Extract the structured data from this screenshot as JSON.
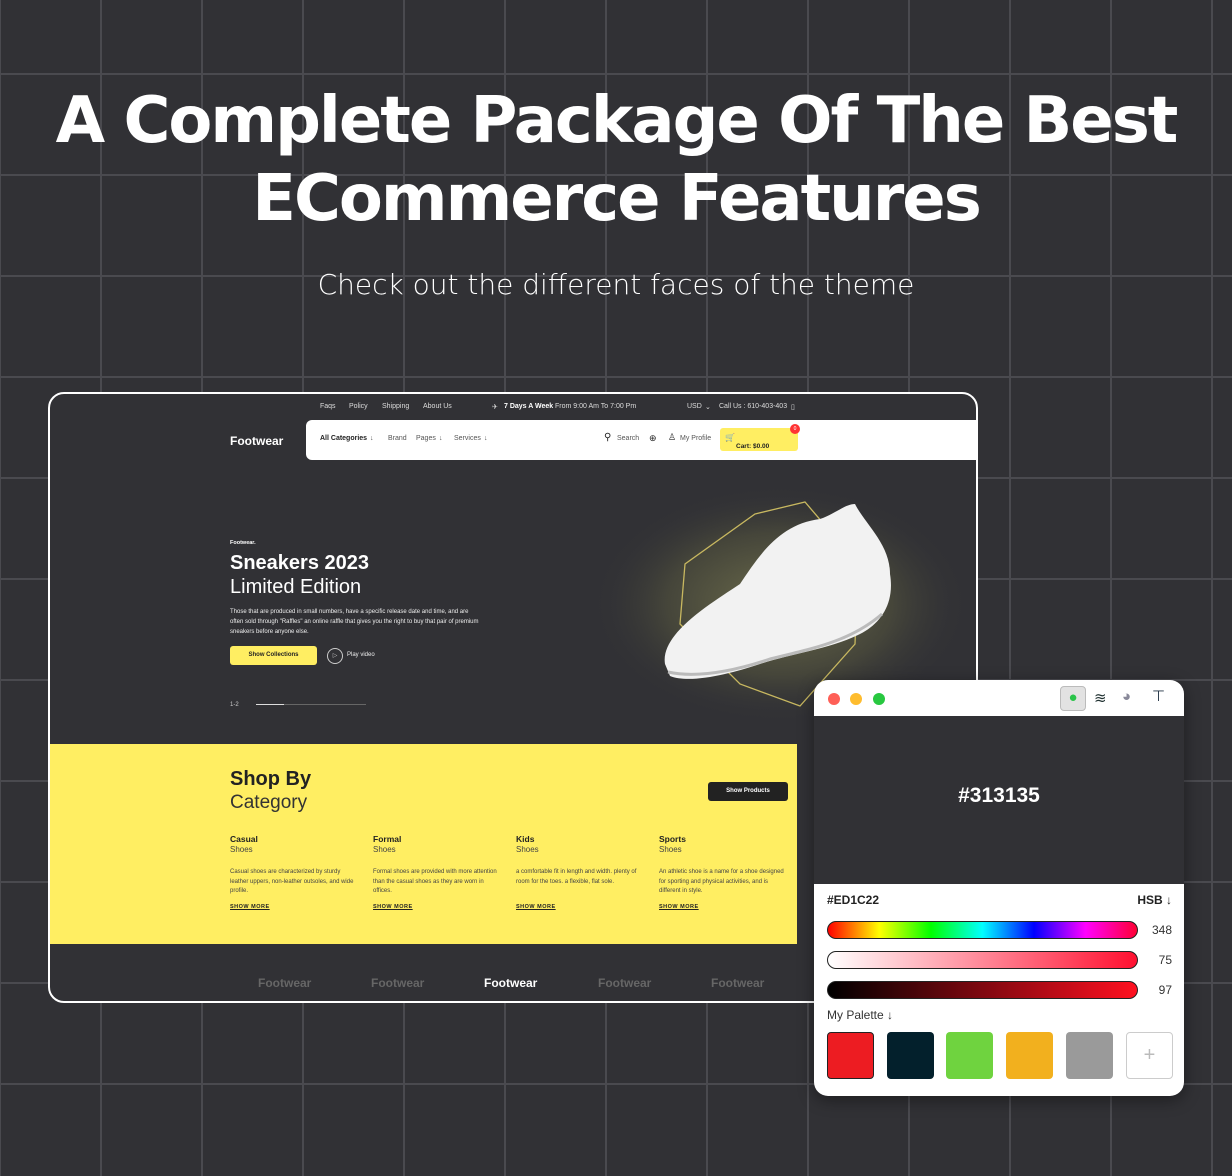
{
  "headline": "A Complete Package Of The Best ECommerce Features",
  "subtitle": "Check out the different faces of the theme",
  "site": {
    "topbar": {
      "links": [
        "Faqs",
        "Policy",
        "Shipping",
        "About Us"
      ],
      "hours_bold": "7 Days A Week",
      "hours": "From 9:00 Am To 7:00 Pm",
      "currency": "USD",
      "call": "Call Us : 610-403-403"
    },
    "logo": "Footwear",
    "nav": {
      "items": [
        "All Categories",
        "Brand",
        "Pages",
        "Services"
      ],
      "search": "Search",
      "profile": "My Profile",
      "cart": "Cart: $0.00",
      "cart_count": "0"
    },
    "hero": {
      "eyebrow": "Footwear.",
      "title": "Sneakers 2023",
      "title2": "Limited Edition",
      "text": "Those that are produced in small numbers, have a specific release date and time, and are often sold through \"Raffles\" an online raffle that gives you the right to buy that pair of premium sneakers before anyone else.",
      "cta": "Show Collections",
      "play": "Play video",
      "pager": "1-2",
      "progress": 0.25
    },
    "shop": {
      "title": "Shop By",
      "title2": "Category",
      "button": "Show Products",
      "categories": [
        {
          "title": "Casual",
          "sub": "Shoes",
          "text": "Casual shoes are characterized by sturdy leather uppers, non-leather outsoles, and wide profile.",
          "more": "SHOW MORE"
        },
        {
          "title": "Formal",
          "sub": "Shoes",
          "text": "Formal shoes are provided with more attention than the casual shoes as they are worn in offices.",
          "more": "SHOW MORE"
        },
        {
          "title": "Kids",
          "sub": "Shoes",
          "text": "a comfortable fit in length and width. plenty of room for the toes. a flexible, flat sole.",
          "more": "SHOW MORE"
        },
        {
          "title": "Sports",
          "sub": "Shoes",
          "text": "An athletic shoe is a name for a shoe designed for sporting and physical activities, and is different in style.",
          "more": "SHOW MORE"
        }
      ]
    },
    "brands": [
      "Footwear",
      "Footwear",
      "Footwear",
      "Footwear",
      "Footwear"
    ]
  },
  "picker": {
    "preview_hex": "#313135",
    "current_hex": "#ED1C22",
    "mode": "HSB",
    "h": "348",
    "s": "75",
    "b": "97",
    "palette_label": "My Palette",
    "palette": [
      "#ED1C22",
      "#03202C",
      "#6FD33F",
      "#F2B01E",
      "#9A9A9A"
    ]
  }
}
